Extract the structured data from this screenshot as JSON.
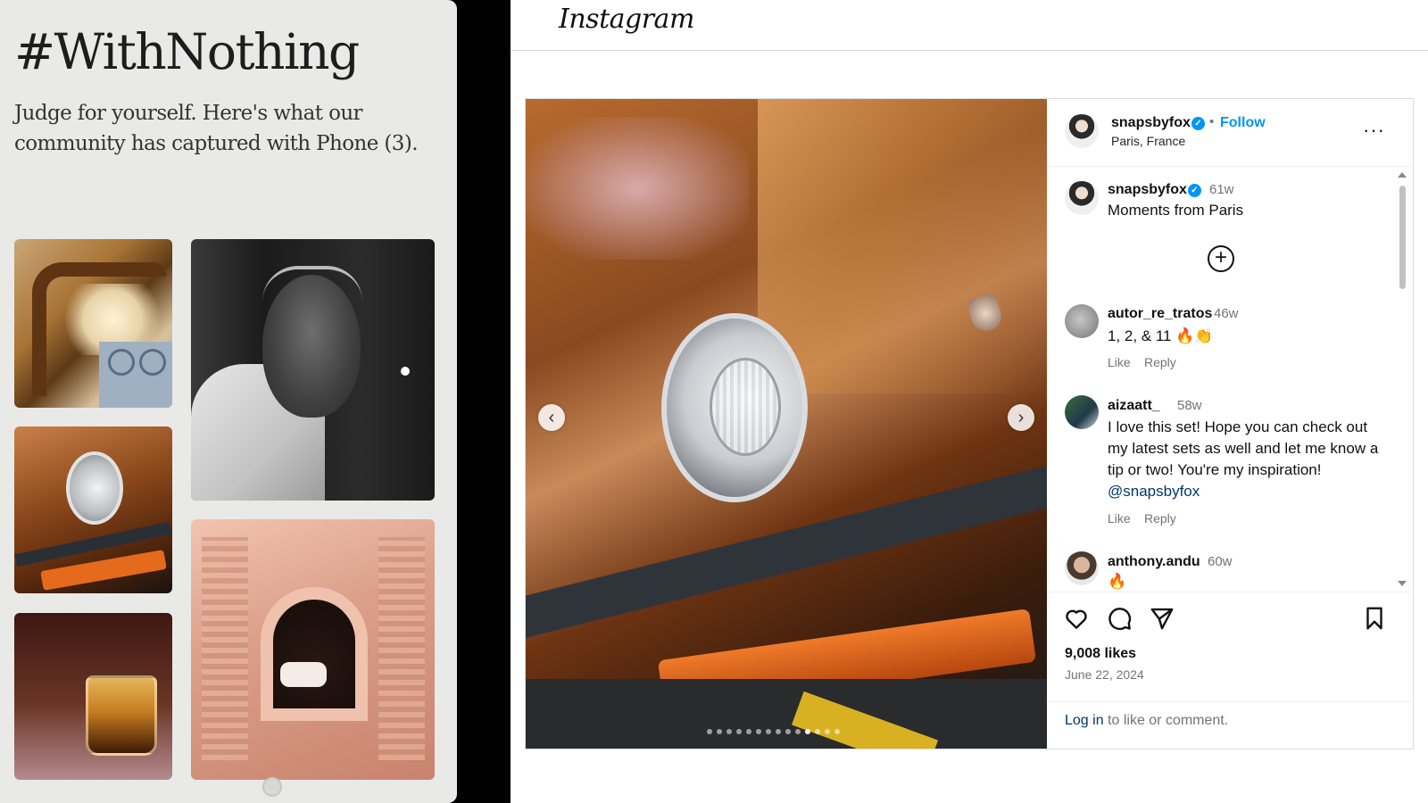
{
  "left_panel": {
    "hashtag": "#WithNothing",
    "tagline": "Judge for yourself. Here's what our community has captured with Phone (3)."
  },
  "header": {
    "logo": "Instagram"
  },
  "post": {
    "author": "snapsbyfox",
    "follow_label": "Follow",
    "location": "Paris, France",
    "more_label": "···",
    "prev_label": "‹",
    "next_label": "›",
    "carousel": {
      "total": 14,
      "current": 11
    },
    "caption": {
      "user": "snapsbyfox",
      "age": "61w",
      "text": "Moments from Paris"
    },
    "plus_label": "+",
    "comments": [
      {
        "user": "autor_re_tratos",
        "age": "46w",
        "text": "1, 2, & 11 🔥👏",
        "like": "Like",
        "reply": "Reply"
      },
      {
        "user": "aizaatt_",
        "age": "58w",
        "text": "I love this set! Hope you can check out my latest sets as well and let me know a tip or two! You're my inspiration!",
        "mention": "@snapsbyfox",
        "like": "Like",
        "reply": "Reply"
      },
      {
        "user": "anthony.andu",
        "age": "60w",
        "text": "🔥"
      }
    ],
    "likes": "9,008 likes",
    "date": "June 22, 2024",
    "login_link": "Log in",
    "login_rest": " to like or comment."
  },
  "colors": {
    "link_blue": "#0095f6",
    "mention": "#00376b",
    "muted": "#737373"
  },
  "icons": [
    "verified-badge-icon",
    "more-options-icon",
    "chevron-left-icon",
    "chevron-right-icon",
    "plus-circle-icon",
    "heart-icon",
    "comment-icon",
    "share-icon",
    "bookmark-icon"
  ]
}
